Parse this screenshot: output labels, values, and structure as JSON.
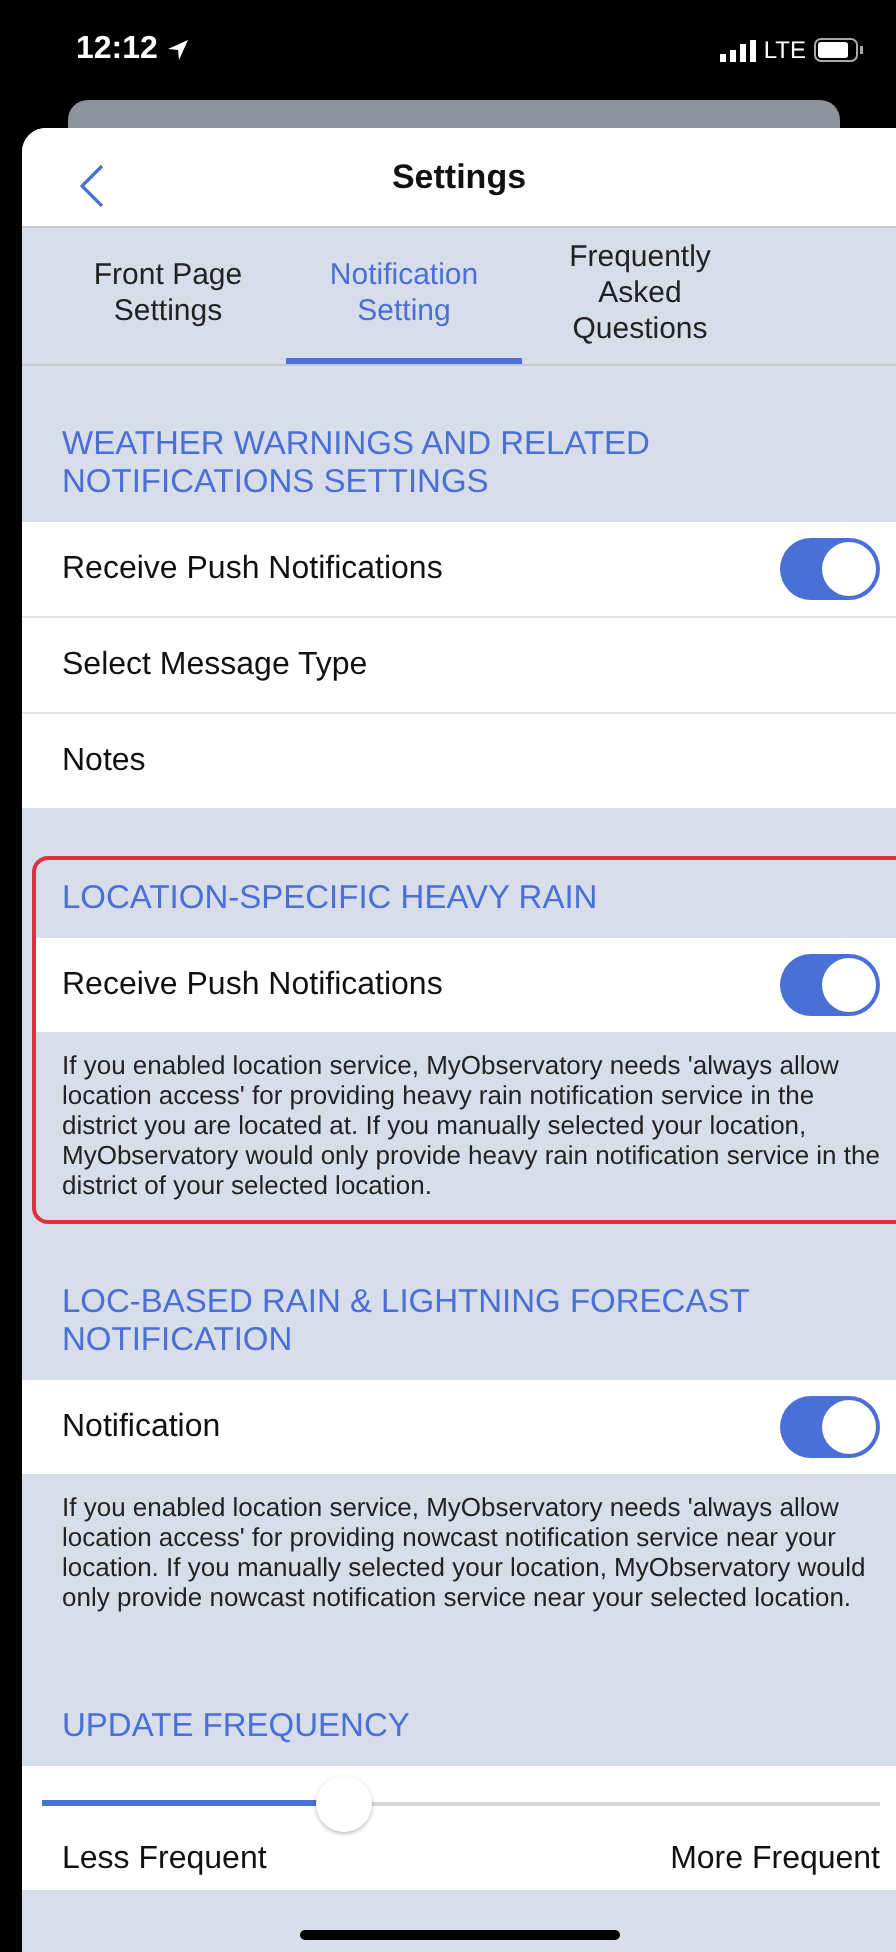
{
  "status_bar": {
    "time": "12:12",
    "network": "LTE"
  },
  "header": {
    "title": "Settings"
  },
  "tabs": [
    {
      "label": "Front Page\nSettings",
      "selected": false
    },
    {
      "label": "Notification\nSetting",
      "selected": true
    },
    {
      "label": "Frequently\nAsked\nQuestions",
      "selected": false
    }
  ],
  "sections": [
    {
      "title": "WEATHER WARNINGS AND RELATED NOTIFICATIONS SETTINGS",
      "highlighted": false,
      "rows": [
        {
          "kind": "toggle",
          "label": "Receive Push Notifications",
          "on": true
        },
        {
          "kind": "link",
          "label": "Select Message Type"
        },
        {
          "kind": "link",
          "label": "Notes"
        }
      ]
    },
    {
      "title": "LOCATION-SPECIFIC HEAVY RAIN",
      "highlighted": true,
      "rows": [
        {
          "kind": "toggle",
          "label": "Receive Push Notifications",
          "on": true
        }
      ],
      "note": "If you enabled location service, MyObservatory needs 'always allow location access' for providing heavy rain notification service in the district you are located at. If you manually selected your location, MyObservatory would only provide heavy rain notification service in the district of your selected location."
    },
    {
      "title": "LOC-BASED RAIN & LIGHTNING FORECAST NOTIFICATION",
      "highlighted": false,
      "rows": [
        {
          "kind": "toggle",
          "label": "Notification",
          "on": true
        }
      ],
      "note": "If you enabled location service, MyObservatory needs 'always allow location access' for providing nowcast notification service near your location. If you manually selected your location, MyObservatory would only provide nowcast notification service near your selected location."
    },
    {
      "title": "UPDATE FREQUENCY",
      "highlighted": false,
      "slider": {
        "level": 0.36,
        "min_label": "Less Frequent",
        "max_label": "More Frequent"
      }
    }
  ]
}
